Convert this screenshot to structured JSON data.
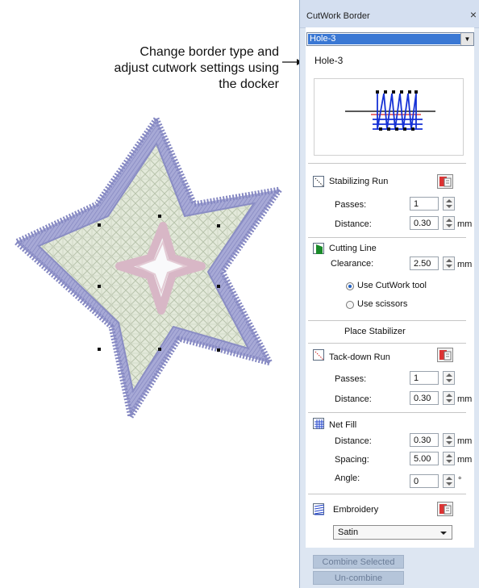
{
  "callout": {
    "lines": [
      "Change border type and",
      "adjust cutwork settings using",
      "the docker"
    ]
  },
  "docker": {
    "title": "CutWork Border",
    "close_glyph": "×",
    "border_type": "Hole-3",
    "preview_label": "Hole-3",
    "stabilizing_run": {
      "label": "Stabilizing Run",
      "passes_label": "Passes:",
      "passes": "1",
      "distance_label": "Distance:",
      "distance": "0.30",
      "unit": "mm"
    },
    "cutting_line": {
      "label": "Cutting Line",
      "clearance_label": "Clearance:",
      "clearance": "2.50",
      "unit": "mm",
      "option_tool": "Use CutWork tool",
      "option_scissors": "Use scissors",
      "selected": "Use CutWork tool"
    },
    "place_stabilizer": "Place Stabilizer",
    "tackdown_run": {
      "label": "Tack-down Run",
      "passes_label": "Passes:",
      "passes": "1",
      "distance_label": "Distance:",
      "distance": "0.30",
      "unit": "mm"
    },
    "net_fill": {
      "label": "Net Fill",
      "distance_label": "Distance:",
      "distance": "0.30",
      "spacing_label": "Spacing:",
      "spacing": "5.00",
      "angle_label": "Angle:",
      "angle": "0",
      "unit": "mm",
      "angle_unit": "°"
    },
    "embroidery": {
      "label": "Embroidery",
      "stitch_type": "Satin"
    },
    "buttons": {
      "combine": "Combine Selected",
      "uncombine": "Un-combine"
    }
  },
  "colors": {
    "border_outer": "#9c9ecf",
    "fill": "#dfe6d6",
    "center_star": "#e8d3dc",
    "selection_blue": "#3a78d4"
  }
}
